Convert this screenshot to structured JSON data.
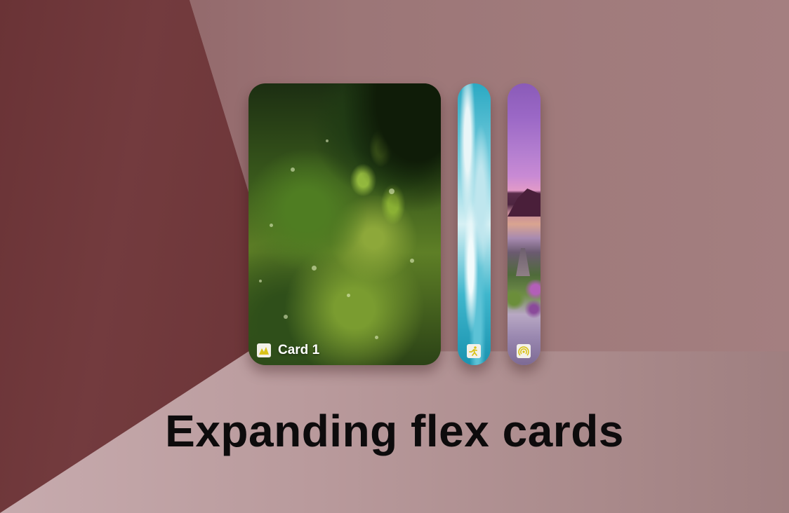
{
  "page": {
    "title": "Expanding flex cards"
  },
  "cards": [
    {
      "label": "Card 1",
      "icon": "mountain-icon",
      "expanded": true
    },
    {
      "label": "",
      "icon": "walking-person-icon",
      "expanded": false
    },
    {
      "label": "",
      "icon": "broadcast-icon",
      "expanded": false
    }
  ],
  "colors": {
    "background_dark": "#6b3437",
    "background_mid": "#9c7677",
    "background_light": "#c7abae",
    "icon_accent": "#d9c21a",
    "headline": "#0d0b0c"
  }
}
